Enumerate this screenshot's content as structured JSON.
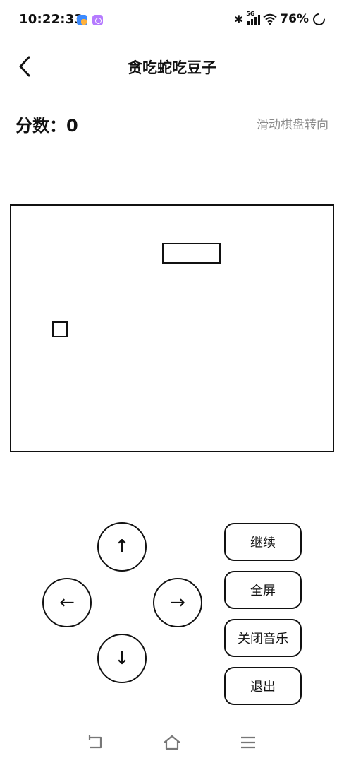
{
  "status_bar": {
    "time": "10:22:33",
    "network": "5G",
    "battery": "76%"
  },
  "header": {
    "title": "贪吃蛇吃豆子"
  },
  "game": {
    "score_text": "分数：0",
    "hint": "滑动棋盘转向"
  },
  "controls": {
    "up": "↑",
    "down": "↓",
    "left": "←",
    "right": "→"
  },
  "actions": {
    "continue": "继续",
    "fullscreen": "全屏",
    "music": "关闭音乐",
    "exit": "退出"
  },
  "icons": {
    "back": "chevron-left-icon",
    "nav_back": "return-icon",
    "nav_home": "home-icon",
    "nav_menu": "menu-icon"
  }
}
